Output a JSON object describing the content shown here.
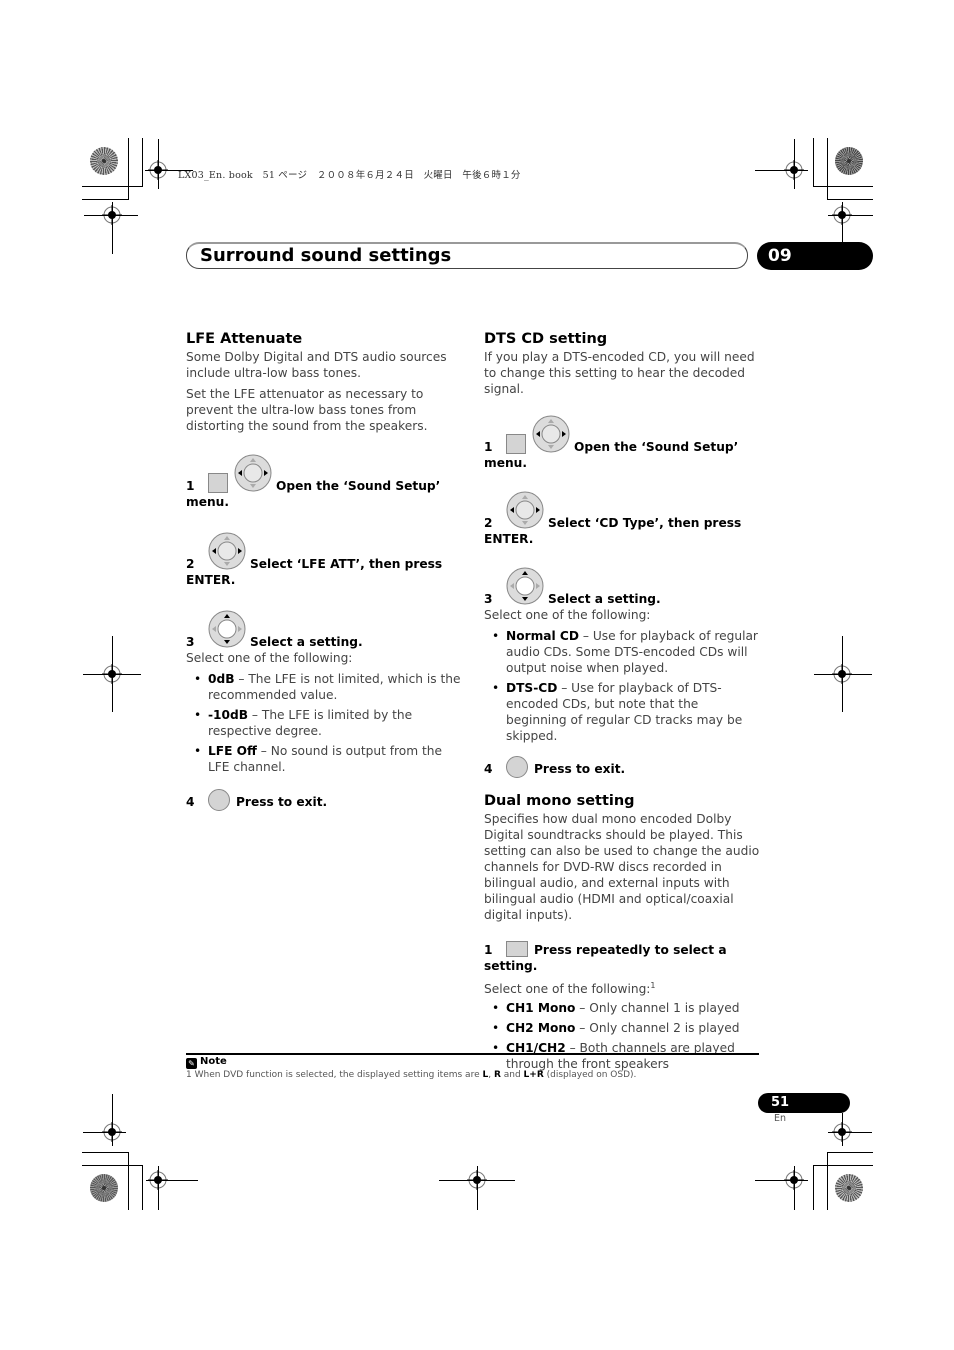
{
  "print_header": "LX03_En. book　51 ページ　２００８年６月２４日　火曜日　午後６時１分",
  "header": {
    "title": "Surround sound settings",
    "chapter": "09"
  },
  "lfe": {
    "heading": "LFE Attenuate",
    "intro1": "Some Dolby Digital and DTS audio sources include ultra-low bass tones.",
    "intro2": "Set the LFE attenuator as necessary to prevent the ultra-low bass tones from distorting the sound from the speakers.",
    "steps": [
      {
        "num": "1",
        "text": "Open the ‘Sound Setup’ menu.",
        "icons": [
          "square-button-icon",
          "joystick-left-right-icon"
        ]
      },
      {
        "num": "2",
        "text": "Select ‘LFE ATT’, then press ENTER.",
        "icons": [
          "joystick-left-right-icon"
        ]
      },
      {
        "num": "3",
        "text": "Select a setting.",
        "icons": [
          "joystick-up-down-icon"
        ]
      },
      {
        "num": "4",
        "text": "Press to exit.",
        "icons": [
          "round-button-icon"
        ]
      }
    ],
    "select_one": "Select one of the following:",
    "options": [
      {
        "term": "0dB",
        "desc": " – The LFE is not limited, which is the recommended value."
      },
      {
        "term": "-10dB",
        "desc": " – The LFE is limited by the respective degree."
      },
      {
        "term": "LFE Off",
        "desc": " – No sound is output from the LFE channel."
      }
    ]
  },
  "dts": {
    "heading": "DTS CD setting",
    "intro": "If you play a DTS-encoded CD, you will need to change this setting to hear the decoded signal.",
    "steps": [
      {
        "num": "1",
        "text": "Open the ‘Sound Setup’ menu.",
        "icons": [
          "square-button-icon",
          "joystick-left-right-icon"
        ]
      },
      {
        "num": "2",
        "text": "Select ‘CD Type’, then press ENTER.",
        "icons": [
          "joystick-left-right-icon"
        ]
      },
      {
        "num": "3",
        "text": "Select a setting.",
        "icons": [
          "joystick-up-down-icon"
        ]
      },
      {
        "num": "4",
        "text": "Press to exit.",
        "icons": [
          "round-button-icon"
        ]
      }
    ],
    "select_one": "Select one of the following:",
    "options": [
      {
        "term": "Normal CD",
        "desc": " – Use for playback of regular audio CDs. Some DTS-encoded CDs will output noise when played."
      },
      {
        "term": "DTS-CD",
        "desc": " – Use for playback of DTS-encoded CDs, but note that the beginning of regular CD tracks may be skipped."
      }
    ]
  },
  "dual": {
    "heading": "Dual mono setting",
    "intro": "Specifies how dual mono encoded Dolby Digital soundtracks should be played. This setting can also be used to change the audio channels for DVD-RW discs recorded in bilingual audio, and external inputs with bilingual audio (HDMI and optical/coaxial digital inputs).",
    "steps": [
      {
        "num": "1",
        "text": "Press repeatedly to select a setting.",
        "icons": [
          "wide-button-icon"
        ]
      }
    ],
    "select_one": "Select one of the following:",
    "footnote_ref": "1",
    "options": [
      {
        "term": "CH1 Mono",
        "desc": " – Only channel 1 is played"
      },
      {
        "term": "CH2 Mono",
        "desc": " – Only channel 2 is played"
      },
      {
        "term": "CH1/CH2",
        "desc": " – Both channels are played through the front speakers"
      }
    ]
  },
  "note": {
    "label": "Note",
    "number": "1",
    "text_before": " When DVD function is selected, the displayed setting items are ",
    "item1": "L",
    "sep1": ", ",
    "item2": "R",
    "sep2": " and ",
    "item3": "L+R",
    "text_after": " (displayed on OSD)."
  },
  "footer": {
    "page": "51",
    "lang": "En"
  }
}
